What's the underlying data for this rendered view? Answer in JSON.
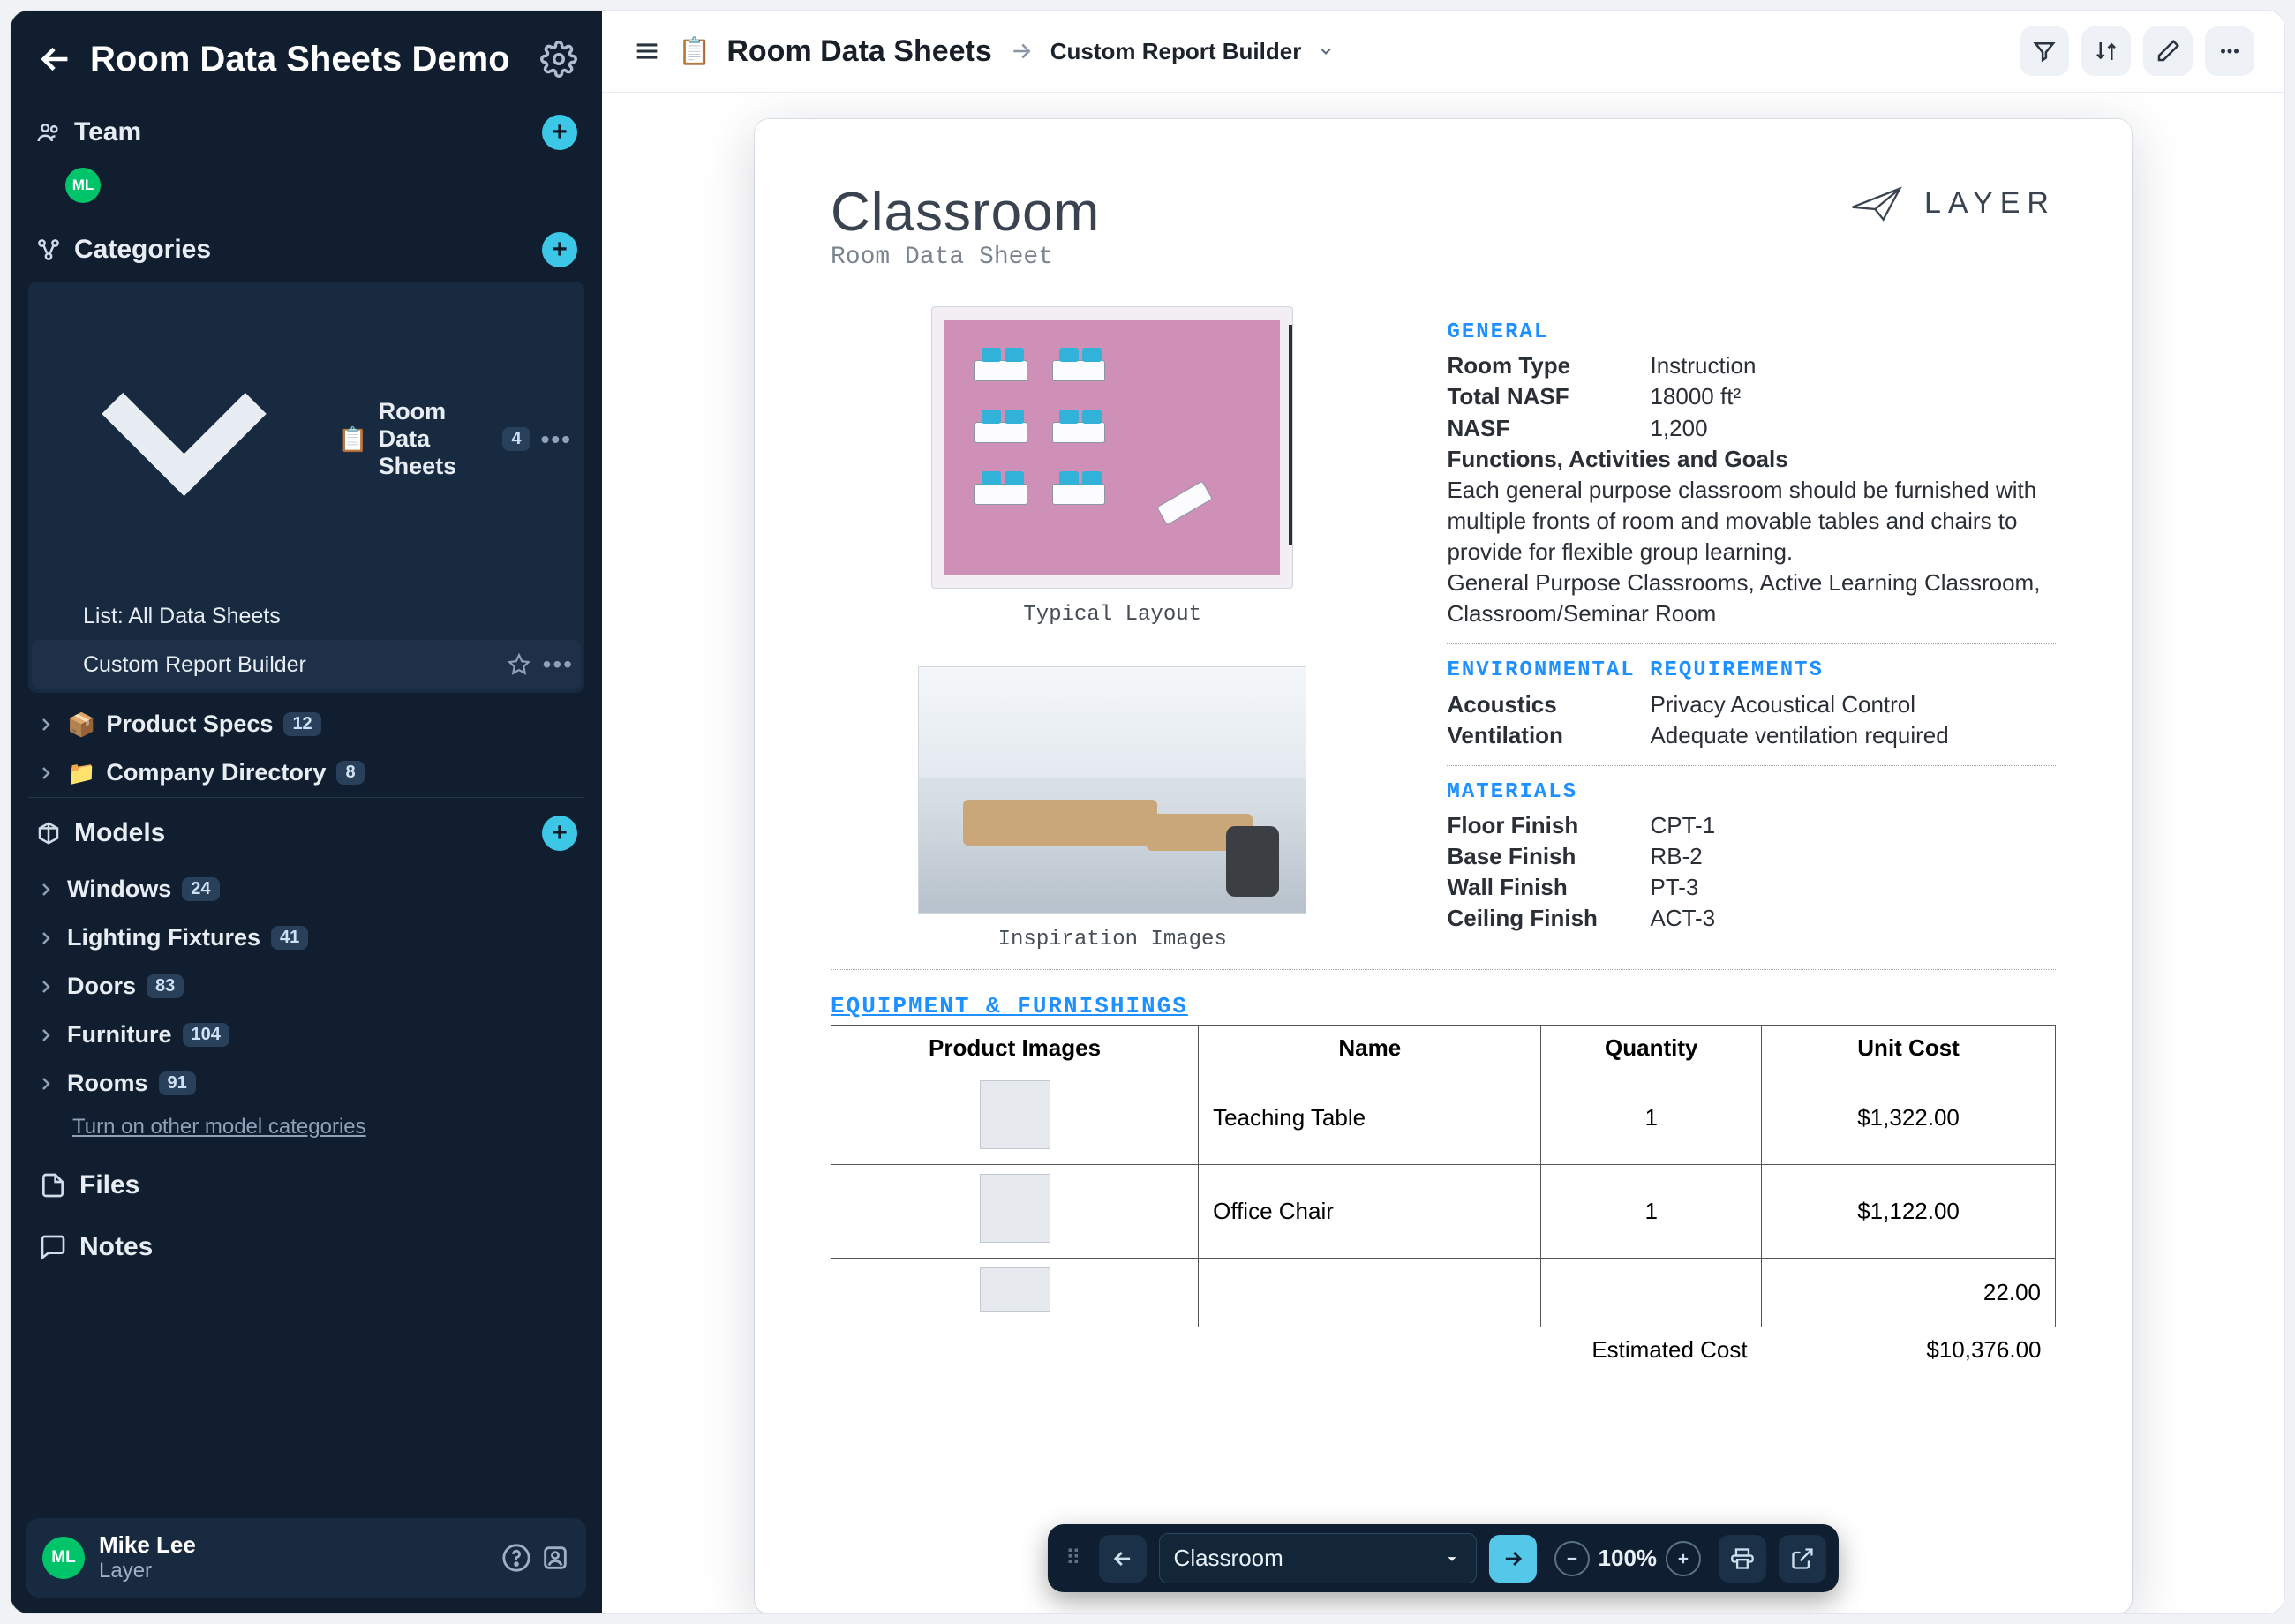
{
  "sidebar": {
    "title": "Room Data Sheets Demo",
    "team": {
      "label": "Team",
      "avatar_initials": "ML"
    },
    "categories": {
      "label": "Categories",
      "items": [
        {
          "label": "Room Data Sheets",
          "badge": "4",
          "icon": "📋",
          "expanded": true,
          "children": [
            {
              "label": "List: All Data Sheets"
            },
            {
              "label": "Custom Report Builder",
              "active": true
            }
          ]
        },
        {
          "label": "Product Specs",
          "badge": "12",
          "icon": "📦"
        },
        {
          "label": "Company Directory",
          "badge": "8",
          "icon": "📁"
        }
      ]
    },
    "models": {
      "label": "Models",
      "items": [
        {
          "label": "Windows",
          "badge": "24"
        },
        {
          "label": "Lighting Fixtures",
          "badge": "41"
        },
        {
          "label": "Doors",
          "badge": "83"
        },
        {
          "label": "Furniture",
          "badge": "104"
        },
        {
          "label": "Rooms",
          "badge": "91"
        }
      ],
      "more_link": "Turn on other model categories"
    },
    "nav": {
      "files": "Files",
      "notes": "Notes"
    },
    "user": {
      "initials": "ML",
      "name": "Mike Lee",
      "org": "Layer"
    }
  },
  "topbar": {
    "icon": "📋",
    "title": "Room Data Sheets",
    "crumb": "Custom Report Builder"
  },
  "document": {
    "title": "Classroom",
    "subtitle": "Room Data Sheet",
    "brand": "LAYER",
    "left": {
      "fig1_caption": "Typical Layout",
      "fig2_caption": "Inspiration Images"
    },
    "general": {
      "label": "GENERAL",
      "room_type_k": "Room Type",
      "room_type_v": "Instruction",
      "total_nasf_k": "Total NASF",
      "total_nasf_v": "18000 ft²",
      "nasf_k": "NASF",
      "nasf_v": "1,200",
      "func_k": "Functions, Activities and Goals",
      "func_body": "Each general purpose classroom should be furnished with multiple fronts of room and movable tables and chairs to provide for flexible group learning.",
      "func_body2": "General Purpose Classrooms, Active Learning Classroom, Classroom/Seminar Room"
    },
    "env": {
      "label": "ENVIRONMENTAL REQUIREMENTS",
      "acoustics_k": "Acoustics",
      "acoustics_v": "Privacy Acoustical Control",
      "vent_k": "Ventilation",
      "vent_v": "Adequate ventilation required"
    },
    "materials": {
      "label": "MATERIALS",
      "floor_k": "Floor Finish",
      "floor_v": "CPT-1",
      "base_k": "Base Finish",
      "base_v": "RB-2",
      "wall_k": "Wall Finish",
      "wall_v": "PT-3",
      "ceil_k": "Ceiling Finish",
      "ceil_v": "ACT-3"
    },
    "equipment": {
      "label": "EQUIPMENT & FURNISHINGS",
      "headers": {
        "img": "Product Images",
        "name": "Name",
        "qty": "Quantity",
        "cost": "Unit Cost"
      },
      "rows": [
        {
          "name": "Teaching Table",
          "qty": "1",
          "cost": "$1,322.00"
        },
        {
          "name": "Office Chair",
          "qty": "1",
          "cost": "$1,122.00"
        },
        {
          "name": "",
          "qty": "",
          "cost": "22.00"
        }
      ],
      "est_label": "Estimated Cost",
      "est_value": "$10,376.00"
    }
  },
  "floatbar": {
    "select_value": "Classroom",
    "zoom": "100%"
  }
}
